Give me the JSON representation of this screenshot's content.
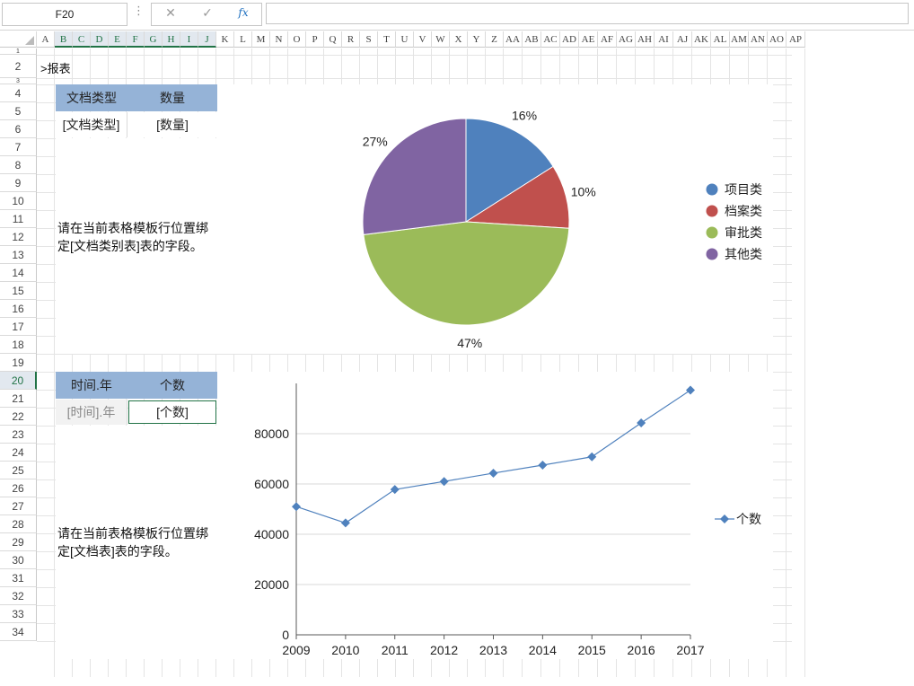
{
  "formula_bar": {
    "name_box": "F20",
    "more_icon": "⋮",
    "cancel_icon": "✕",
    "enter_icon": "✓",
    "fx_icon": "fx",
    "formula": ""
  },
  "columns": [
    "A",
    "B",
    "C",
    "D",
    "E",
    "F",
    "G",
    "H",
    "I",
    "J",
    "K",
    "L",
    "M",
    "N",
    "O",
    "P",
    "Q",
    "R",
    "S",
    "T",
    "U",
    "V",
    "W",
    "X",
    "Y",
    "Z",
    "AA",
    "AB",
    "AC",
    "AD",
    "AE",
    "AF",
    "AG",
    "AH",
    "AI",
    "AJ",
    "AK",
    "AL",
    "AM",
    "AN",
    "AO",
    "AP"
  ],
  "selected_columns": [
    "B",
    "C",
    "D",
    "E",
    "F",
    "G",
    "H",
    "I",
    "J"
  ],
  "rows": [
    1,
    2,
    3,
    4,
    5,
    6,
    7,
    8,
    9,
    10,
    11,
    12,
    13,
    14,
    15,
    16,
    17,
    18,
    19,
    20,
    21,
    22,
    23,
    24,
    25,
    26,
    27,
    28,
    29,
    30,
    31,
    32,
    33,
    34
  ],
  "selected_row": 20,
  "sheet": {
    "report_title": ">报表",
    "table1": {
      "header_type": "文档类型",
      "header_count": "数量",
      "field_type": "[文档类型]",
      "field_count": "[数量]",
      "note": "请在当前表格模板行位置绑定[文档类别表]表的字段。"
    },
    "table2": {
      "header_year": "时间.年",
      "header_count": "个数",
      "field_year": "[时间].年",
      "field_count": "[个数]",
      "note": "请在当前表格模板行位置绑定[文档表]表的字段。"
    }
  },
  "chart_data": [
    {
      "type": "pie",
      "categories": [
        "项目类",
        "档案类",
        "审批类",
        "其他类"
      ],
      "values": [
        16,
        10,
        47,
        27
      ],
      "labels": [
        "16%",
        "10%",
        "47%",
        "27%"
      ],
      "colors": [
        "#4f81bd",
        "#c0504d",
        "#9bbb59",
        "#8064a2"
      ],
      "legend": "right"
    },
    {
      "type": "line",
      "x": [
        "2009",
        "2010",
        "2011",
        "2012",
        "2013",
        "2014",
        "2015",
        "2016",
        "2017"
      ],
      "series": [
        {
          "name": "个数",
          "values": [
            51000,
            44500,
            57800,
            61000,
            64300,
            67500,
            70800,
            84300,
            97300
          ],
          "color": "#4f81bd",
          "marker": "diamond"
        }
      ],
      "yticks": [
        0,
        20000,
        40000,
        60000,
        80000
      ],
      "ylim": [
        0,
        100000
      ],
      "grid": true,
      "legend": "right"
    }
  ]
}
